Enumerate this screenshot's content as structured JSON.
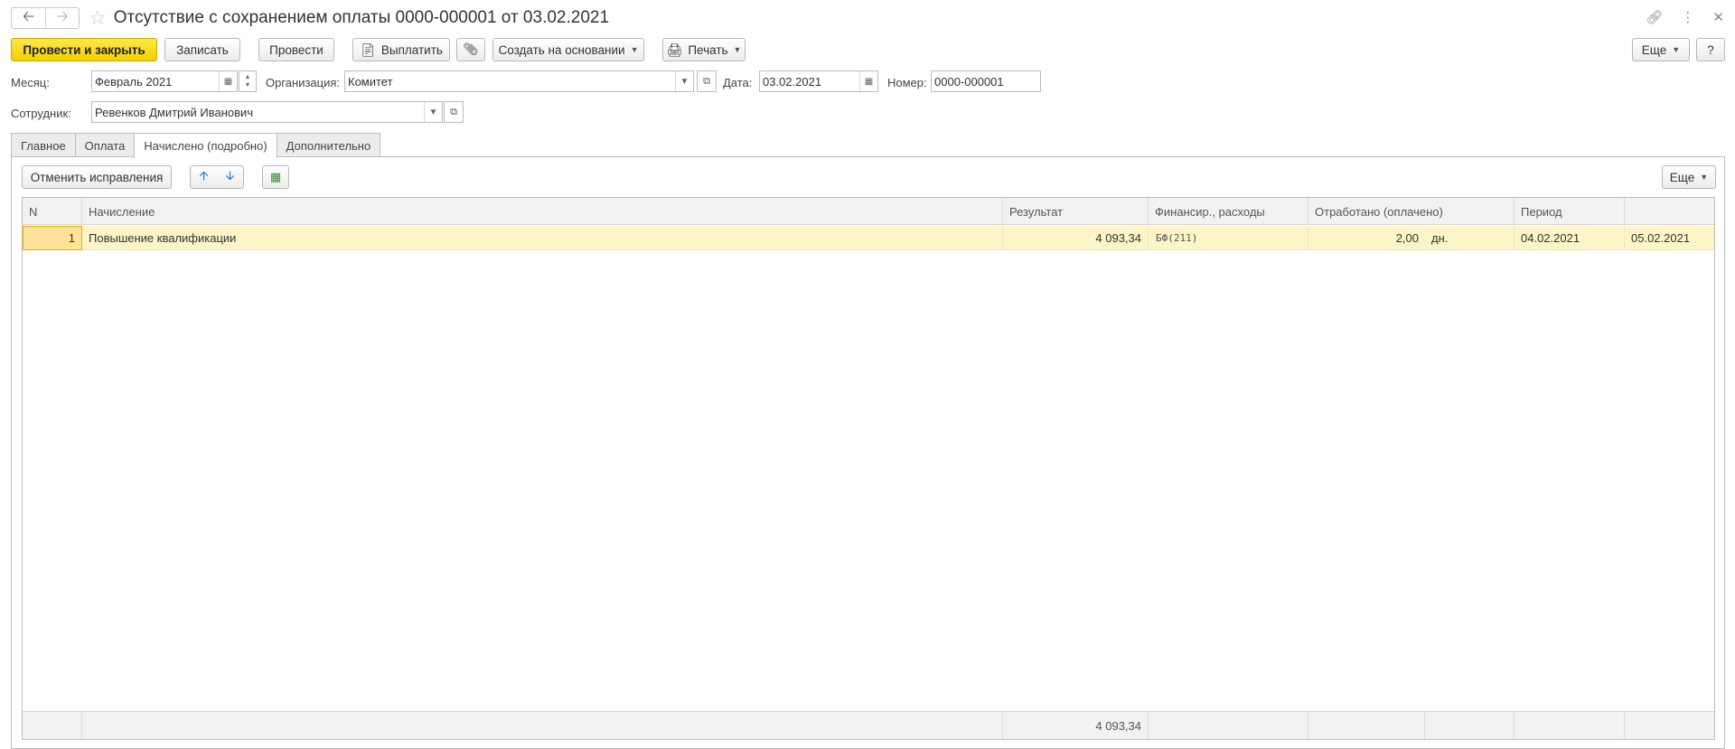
{
  "window": {
    "title": "Отсутствие с сохранением оплаты 0000-000001 от 03.02.2021"
  },
  "toolbar": {
    "post_and_close": "Провести и закрыть",
    "save": "Записать",
    "post": "Провести",
    "pay": "Выплатить",
    "create_based_on": "Создать на основании",
    "print": "Печать",
    "more": "Еще",
    "help": "?"
  },
  "header": {
    "month_label": "Месяц:",
    "month_value": "Февраль 2021",
    "org_label": "Организация:",
    "org_value": "Комитет",
    "date_label": "Дата:",
    "date_value": "03.02.2021",
    "number_label": "Номер:",
    "number_value": "0000-000001",
    "employee_label": "Сотрудник:",
    "employee_value": "Ревенков Дмитрий Иванович"
  },
  "tabs": [
    {
      "label": "Главное"
    },
    {
      "label": "Оплата"
    },
    {
      "label": "Начислено (подробно)"
    },
    {
      "label": "Дополнительно"
    }
  ],
  "panel_toolbar": {
    "cancel_corrections": "Отменить исправления",
    "more": "Еще"
  },
  "table": {
    "columns": [
      "N",
      "Начисление",
      "Результат",
      "Финансир., расходы",
      "Отработано (оплачено)",
      "Период"
    ],
    "rows": [
      {
        "n": "1",
        "accrual": "Повышение квалификации",
        "result": "4 093,34",
        "financing": "БФ(211)",
        "worked": "2,00",
        "unit": "дн.",
        "period_start": "04.02.2021",
        "period_end": "05.02.2021"
      }
    ],
    "total_result": "4 093,34"
  },
  "colors": {
    "primary_button": "#f5d000",
    "selected_row": "#fdf4c8"
  }
}
